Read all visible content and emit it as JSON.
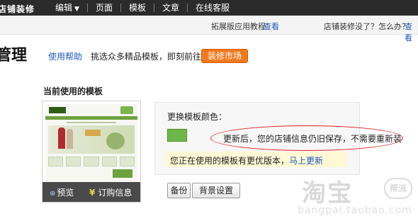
{
  "topbar": {
    "brand": "店铺装修",
    "menu": [
      {
        "label": "编辑",
        "has_caret": true
      },
      {
        "label": "页面"
      },
      {
        "label": "模板"
      },
      {
        "label": "文章"
      },
      {
        "label": "在线客服"
      }
    ]
  },
  "helpbar": {
    "tutorial_text": "拓展版应用教程",
    "tutorial_link": "查看",
    "question_text": "店铺装修没了？怎么办？",
    "question_link": "查看"
  },
  "header": {
    "title": "管理",
    "help_link": "使用帮助",
    "promo_text": "挑选众多精品模板，即刻前往",
    "market_button": "装修市场"
  },
  "current_template": {
    "section_title": "当前使用的模板",
    "preview_label": "预览",
    "order_label": "订购信息",
    "change_color_label": "更换模板颜色：",
    "swatch_color": "#6cb74a",
    "notice_text": "更新后，您的店铺信息仍旧保存，不需要重新装",
    "update_text": "您正在使用的模板有更优版本，",
    "update_link": "马上更新"
  },
  "actions": {
    "backup": "备份",
    "background": "背景设置"
  },
  "watermark": {
    "main": "淘宝",
    "badge": "帮派",
    "url": "bangpai.taobao.com"
  }
}
